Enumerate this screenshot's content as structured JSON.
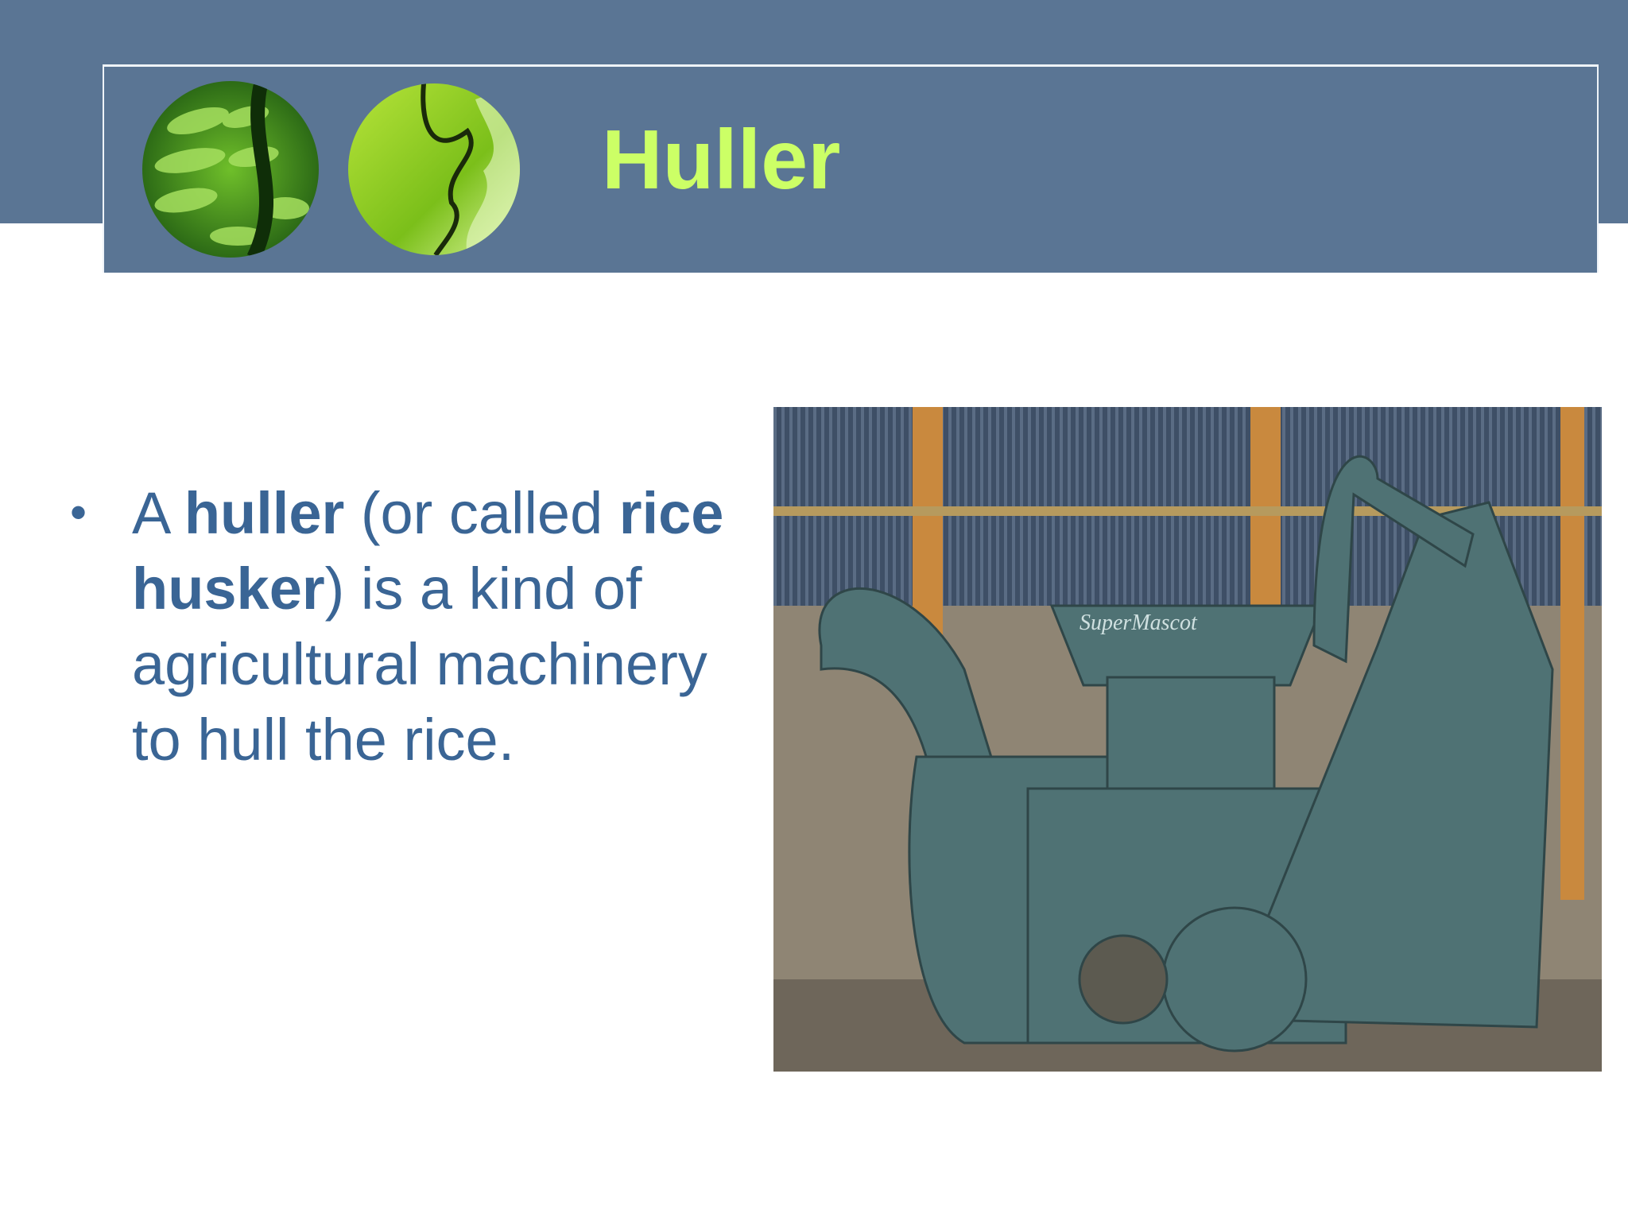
{
  "slide": {
    "title": "Huller",
    "bullet": {
      "t1": "A ",
      "b1": "huller",
      "t2": " (or called ",
      "b2": "rice husker",
      "t3": ") is a kind of agricultural machinery to hull the rice."
    },
    "photo_label": "SuperMascot"
  },
  "colors": {
    "band": "#5a7594",
    "title": "#ccff66",
    "text": "#3a6595"
  }
}
